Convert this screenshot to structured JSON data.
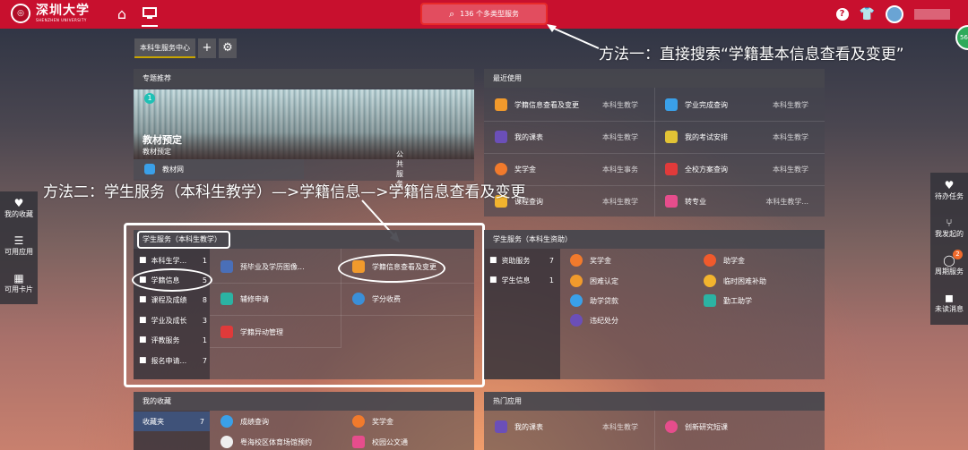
{
  "header": {
    "logo_cn": "深圳大学",
    "logo_en": "SHENZHEN UNIVERSITY",
    "search_label": "136 个多类型服务"
  },
  "tabs": {
    "main": "本科生服务中心",
    "add": "+",
    "settings": "⚙"
  },
  "annotations": {
    "method1": "方法一：直接搜索“学籍基本信息查看及变更”",
    "method2": "方法二：学生服务（本科生教学）—>学籍信息—>学籍信息查看及变更"
  },
  "featured": {
    "title": "专题推荐",
    "badge": "1",
    "item_title": "教材预定",
    "item_sub": "教材预定",
    "link_label": "教材网",
    "link_cat": "公共服务"
  },
  "recent": {
    "title": "最近使用",
    "items": [
      {
        "label": "学籍信息查看及变更",
        "cat": "本科生教学",
        "color": "#f19a2c"
      },
      {
        "label": "学业完成查询",
        "cat": "本科生教学",
        "color": "#3aa0e8"
      },
      {
        "label": "我的课表",
        "cat": "本科生教学",
        "color": "#6b4fb8"
      },
      {
        "label": "我的考试安排",
        "cat": "本科生教学",
        "color": "#e2c335"
      },
      {
        "label": "奖学金",
        "cat": "本科生事务",
        "color": "#f17a2c"
      },
      {
        "label": "全校方案查询",
        "cat": "本科生教学",
        "color": "#e03a3a"
      },
      {
        "label": "课程查询",
        "cat": "本科生教学",
        "color": "#f3b42e"
      },
      {
        "label": "转专业",
        "cat": "本科生教学...",
        "color": "#e64d8c"
      }
    ]
  },
  "student_teaching": {
    "title": "学生服务（本科生教学）",
    "categories": [
      {
        "label": "本科生学...",
        "count": "1"
      },
      {
        "label": "学籍信息",
        "count": "5"
      },
      {
        "label": "课程及成绩",
        "count": "8"
      },
      {
        "label": "学业及成长",
        "count": "3"
      },
      {
        "label": "评教服务",
        "count": "1"
      },
      {
        "label": "报名申请...",
        "count": "7"
      }
    ],
    "services": [
      {
        "label": "预毕业及学历图像...",
        "color": "#4a6fb8"
      },
      {
        "label": "学籍信息查看及变更",
        "color": "#f19a2c"
      },
      {
        "label": "辅修申请",
        "color": "#2bb3a3"
      },
      {
        "label": "学分收费",
        "color": "#3a8fd8"
      },
      {
        "label": "学籍异动管理",
        "color": "#e03a3a"
      }
    ]
  },
  "student_aid": {
    "title": "学生服务（本科生资助）",
    "categories": [
      {
        "label": "资助服务",
        "count": "7"
      },
      {
        "label": "学生信息",
        "count": "1"
      }
    ],
    "services": [
      {
        "label": "奖学金",
        "color": "#f17a2c"
      },
      {
        "label": "助学金",
        "color": "#f05a2c"
      },
      {
        "label": "困难认定",
        "color": "#f19a2c"
      },
      {
        "label": "临时困难补助",
        "color": "#f3b42e"
      },
      {
        "label": "助学贷款",
        "color": "#3aa0e8"
      },
      {
        "label": "勤工助学",
        "color": "#2bb3a3"
      },
      {
        "label": "违纪处分",
        "color": "#6b4fb8"
      }
    ]
  },
  "favorites": {
    "title": "我的收藏",
    "folder": "收藏夹",
    "folder_count": "7",
    "items": [
      {
        "label": "成绩查询",
        "color": "#3aa0e8"
      },
      {
        "label": "奖学金",
        "color": "#f17a2c"
      },
      {
        "label": "粤海校区体育场馆预约",
        "color": "#eeeeee"
      },
      {
        "label": "校园公文通",
        "color": "#e64d8c"
      }
    ]
  },
  "hot": {
    "title": "热门应用",
    "items": [
      {
        "label": "我的课表",
        "cat": "本科生教学",
        "color": "#6b4fb8"
      },
      {
        "label": "创新研究短课",
        "color": "#e64d8c"
      }
    ]
  },
  "left_sidebar": [
    {
      "label": "我的收藏",
      "icon": "heart-icon"
    },
    {
      "label": "可用应用",
      "icon": "list-icon"
    },
    {
      "label": "可用卡片",
      "icon": "grid-icon"
    }
  ],
  "right_sidebar": [
    {
      "label": "待办任务",
      "icon": "heart-icon"
    },
    {
      "label": "我发起的",
      "icon": "flow-icon"
    },
    {
      "label": "周期服务",
      "icon": "shield-check-icon",
      "badge": "2"
    },
    {
      "label": "未读消息",
      "icon": "message-icon"
    }
  ],
  "corner_badge": "56"
}
